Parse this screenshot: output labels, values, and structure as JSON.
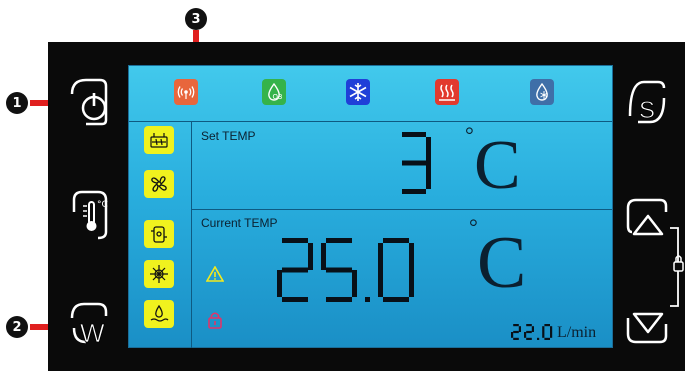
{
  "callouts": {
    "one": "1",
    "two": "2",
    "three": "3"
  },
  "set_temp": {
    "label": "Set TEMP",
    "value": "3",
    "unit": "C"
  },
  "current_temp": {
    "label": "Current TEMP",
    "value": "25.0",
    "unit": "C"
  },
  "flow": {
    "value": "22.0",
    "unit": "L/min"
  },
  "status_icons": [
    "wifi-icon",
    "ozone-icon",
    "cooling-snowflake-icon",
    "heating-icon",
    "water-cooling-icon"
  ],
  "status_icon_labels": {
    "ozone": "O3"
  },
  "side_icons": [
    "ice-bath-icon",
    "fan-icon",
    "pump-icon",
    "compressor-icon",
    "water-level-icon"
  ],
  "colors": {
    "screen": "#29aede",
    "side_icon_bg": "#f0f21e",
    "wifi": "#e8663c",
    "ozone": "#35b34a",
    "cool": "#1f3fd8",
    "heat": "#e23a2e",
    "water": "#3f6fa8",
    "arrow": "#e0201f"
  }
}
